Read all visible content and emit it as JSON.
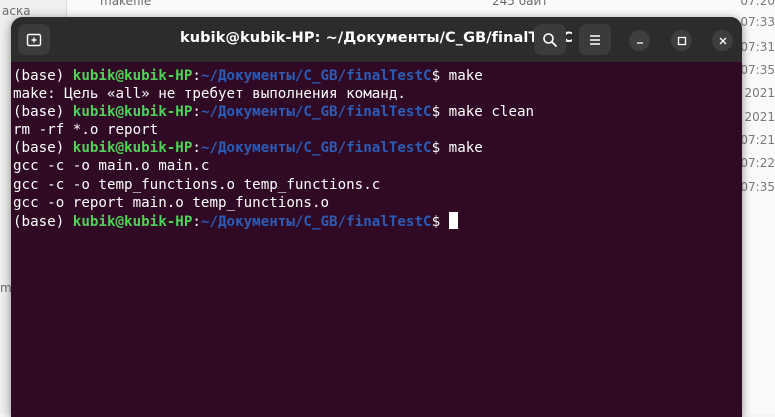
{
  "background": {
    "top_left_text": "м",
    "top_right_text": "makefile",
    "top_size": "245 байт",
    "side_label_1": "аска",
    "side_label_2": "m",
    "times": [
      "07:20",
      "07:33",
      "07:31",
      "07:35",
      "2021",
      "2021",
      "07:21",
      "07:22",
      "07:35"
    ]
  },
  "window": {
    "title": "kubik@kubik-HP: ~/Документы/C_GB/finalTestC",
    "new_tab_icon": "new-tab-icon",
    "search_icon": "search-icon",
    "menu_icon": "hamburger-menu-icon",
    "minimize_icon": "minimize-icon",
    "maximize_icon": "maximize-icon",
    "close_icon": "close-icon"
  },
  "terminal": {
    "env": "(base)",
    "user_host": "kubik@kubik-HP",
    "colon": ":",
    "path": "~/Документы/C_GB/finalTestC",
    "dollar": "$",
    "lines": [
      {
        "kind": "prompt",
        "command": " make"
      },
      {
        "kind": "output",
        "text": "make: Цель «all» не требует выполнения команд."
      },
      {
        "kind": "prompt",
        "command": " make clean"
      },
      {
        "kind": "output",
        "text": "rm -rf *.o report"
      },
      {
        "kind": "prompt",
        "command": " make"
      },
      {
        "kind": "output",
        "text": "gcc -c -o main.o main.c"
      },
      {
        "kind": "output",
        "text": "gcc -c -o temp_functions.o temp_functions.c"
      },
      {
        "kind": "output",
        "text": "gcc -o report main.o temp_functions.o"
      },
      {
        "kind": "prompt",
        "command": " "
      }
    ]
  },
  "colors": {
    "terminal_bg": "#300a24",
    "user_green": "#4fd15a",
    "path_blue": "#2c5cb5",
    "titlebar": "#2c2c2c"
  }
}
